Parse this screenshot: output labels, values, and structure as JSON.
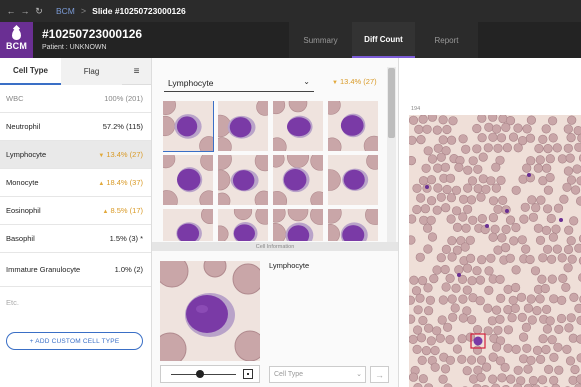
{
  "topbar": {
    "back_icon": "back-arrow-icon",
    "forward_icon": "forward-arrow-icon",
    "refresh_icon": "refresh-icon",
    "breadcrumb": "BCM",
    "separator": ">",
    "title": "Slide #10250723000126"
  },
  "header": {
    "logo_text": "BCM",
    "slide_title": "#10250723000126",
    "patient": "Patient : UNKNOWN",
    "tabs": [
      {
        "label": "Summary",
        "active": false
      },
      {
        "label": "Diff Count",
        "active": true
      },
      {
        "label": "Report",
        "active": false
      }
    ]
  },
  "left": {
    "tabs": [
      {
        "label": "Cell Type",
        "active": true
      },
      {
        "label": "Flag",
        "active": false
      }
    ],
    "menu_icon": "collapse-menu-icon",
    "cells": [
      {
        "name": "WBC",
        "value": "100% (201)",
        "muted": true,
        "arrow": "",
        "highlight": false
      },
      {
        "name": "Neutrophil",
        "value": "57.2% (115)",
        "muted": false,
        "arrow": "",
        "highlight": false
      },
      {
        "name": "Lymphocyte",
        "value": "13.4% (27)",
        "muted": false,
        "arrow": "down",
        "highlight": true
      },
      {
        "name": "Monocyte",
        "value": "18.4% (37)",
        "muted": false,
        "arrow": "up",
        "highlight": true
      },
      {
        "name": "Eosinophil",
        "value": "8.5% (17)",
        "muted": false,
        "arrow": "up",
        "highlight": true
      },
      {
        "name": "Basophil",
        "value": "1.5% (3) *",
        "muted": false,
        "arrow": "",
        "highlight": false
      },
      {
        "name": "Immature Granulocyte",
        "value": "1.0% (2)",
        "muted": false,
        "arrow": "",
        "highlight": false
      }
    ],
    "etc": "Etc.",
    "add_button": "+ ADD CUSTOM CELL TYPE"
  },
  "middle": {
    "selected_type": "Lymphocyte",
    "selected_pct": "13.4% (27)",
    "thumbnail_count": 12,
    "cell_info_label": "Cell Information",
    "cell_info_name": "Lymphocyte",
    "cell_type_placeholder": "Cell Type",
    "next_icon": "arrow-right-icon",
    "fit_icon": "fit-screen-icon",
    "zoom_level": 0.45
  },
  "right": {
    "slide_index": "194"
  },
  "colors": {
    "accent_purple": "#6a2f93",
    "tab_underline": "#7b5bd6",
    "link_blue": "#3a6fc6",
    "warning_orange": "#d99a26",
    "cell_purple": "#7a3aa6",
    "rbc": "#c9a6a8"
  }
}
